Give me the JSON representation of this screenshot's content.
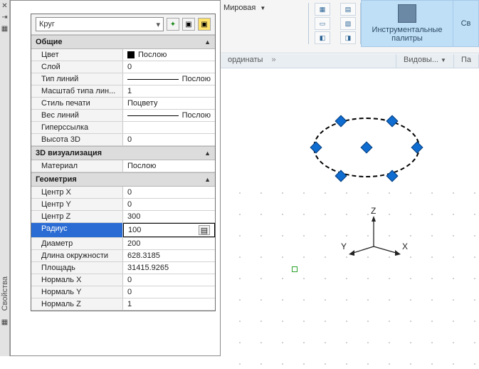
{
  "rail": {
    "title": "Свойства"
  },
  "topstrip": {
    "item": "Мировая"
  },
  "panelTabs": {
    "left": "ординаты",
    "right1": "Видовы...",
    "right2": "Па"
  },
  "ribbon": {
    "big1": "Инструментальные палитры",
    "big2": "Св"
  },
  "object": {
    "type": "Круг"
  },
  "sections": {
    "general": {
      "title": "Общие",
      "rows": {
        "color": {
          "label": "Цвет",
          "value": "Послою"
        },
        "layer": {
          "label": "Слой",
          "value": "0"
        },
        "linetype": {
          "label": "Тип линий",
          "value": "Послою"
        },
        "ltscale": {
          "label": "Масштаб типа лин...",
          "value": "1"
        },
        "plotstyle": {
          "label": "Стиль печати",
          "value": "Поцвету"
        },
        "lineweight": {
          "label": "Вес линий",
          "value": "Послою"
        },
        "hyperlink": {
          "label": "Гиперссылка",
          "value": ""
        },
        "height3d": {
          "label": "Высота 3D",
          "value": "0"
        }
      }
    },
    "viz3d": {
      "title": "3D визуализация",
      "rows": {
        "material": {
          "label": "Материал",
          "value": "Послою"
        }
      }
    },
    "geometry": {
      "title": "Геометрия",
      "rows": {
        "cx": {
          "label": "Центр X",
          "value": "0"
        },
        "cy": {
          "label": "Центр Y",
          "value": "0"
        },
        "cz": {
          "label": "Центр Z",
          "value": "300"
        },
        "radius": {
          "label": "Радиус",
          "value": "100"
        },
        "diameter": {
          "label": "Диаметр",
          "value": "200"
        },
        "circum": {
          "label": "Длина окружности",
          "value": "628.3185"
        },
        "area": {
          "label": "Площадь",
          "value": "31415.9265"
        },
        "nx": {
          "label": "Нормаль X",
          "value": "0"
        },
        "ny": {
          "label": "Нормаль Y",
          "value": "0"
        },
        "nz": {
          "label": "Нормаль Z",
          "value": "1"
        }
      }
    }
  },
  "ucs": {
    "x": "X",
    "y": "Y",
    "z": "Z"
  }
}
